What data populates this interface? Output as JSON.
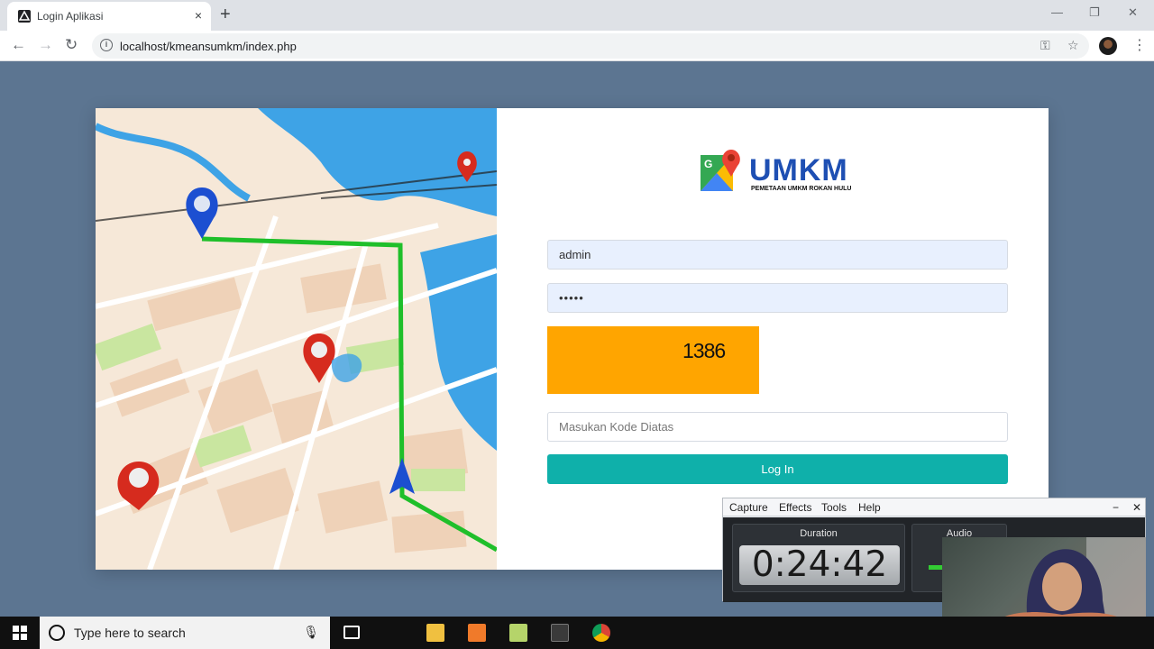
{
  "browser": {
    "tab_title": "Login Aplikasi",
    "tab_close": "×",
    "new_tab": "+",
    "url": "localhost/kmeansumkm/index.php",
    "window_controls": {
      "minimize": "—",
      "restore": "❐",
      "close": "✕"
    },
    "nav": {
      "back": "←",
      "forward": "→",
      "reload": "↻"
    },
    "info_symbol": "i",
    "key_symbol": "⚿",
    "star_symbol": "☆",
    "menu_symbol": "⋮"
  },
  "logo": {
    "title": "UMKM",
    "subtitle": "PEMETAAN UMKM ROKAN HULU"
  },
  "form": {
    "username_value": "admin",
    "password_value": "•••••",
    "captcha_code": "1386",
    "captcha_placeholder": "Masukan Kode Diatas",
    "login_label": "Log In"
  },
  "recorder": {
    "menu": [
      "Capture",
      "Effects",
      "Tools",
      "Help"
    ],
    "minimize": "−",
    "close": "✕",
    "duration_label": "Duration",
    "duration_value": "0:24:42",
    "audio_label": "Audio"
  },
  "taskbar": {
    "search_placeholder": "Type here to search"
  },
  "colors": {
    "page_background": "#5c7591",
    "captcha_background": "#ffa500",
    "login_button": "#0fb0aa",
    "logo_blue": "#1e4fb3"
  }
}
